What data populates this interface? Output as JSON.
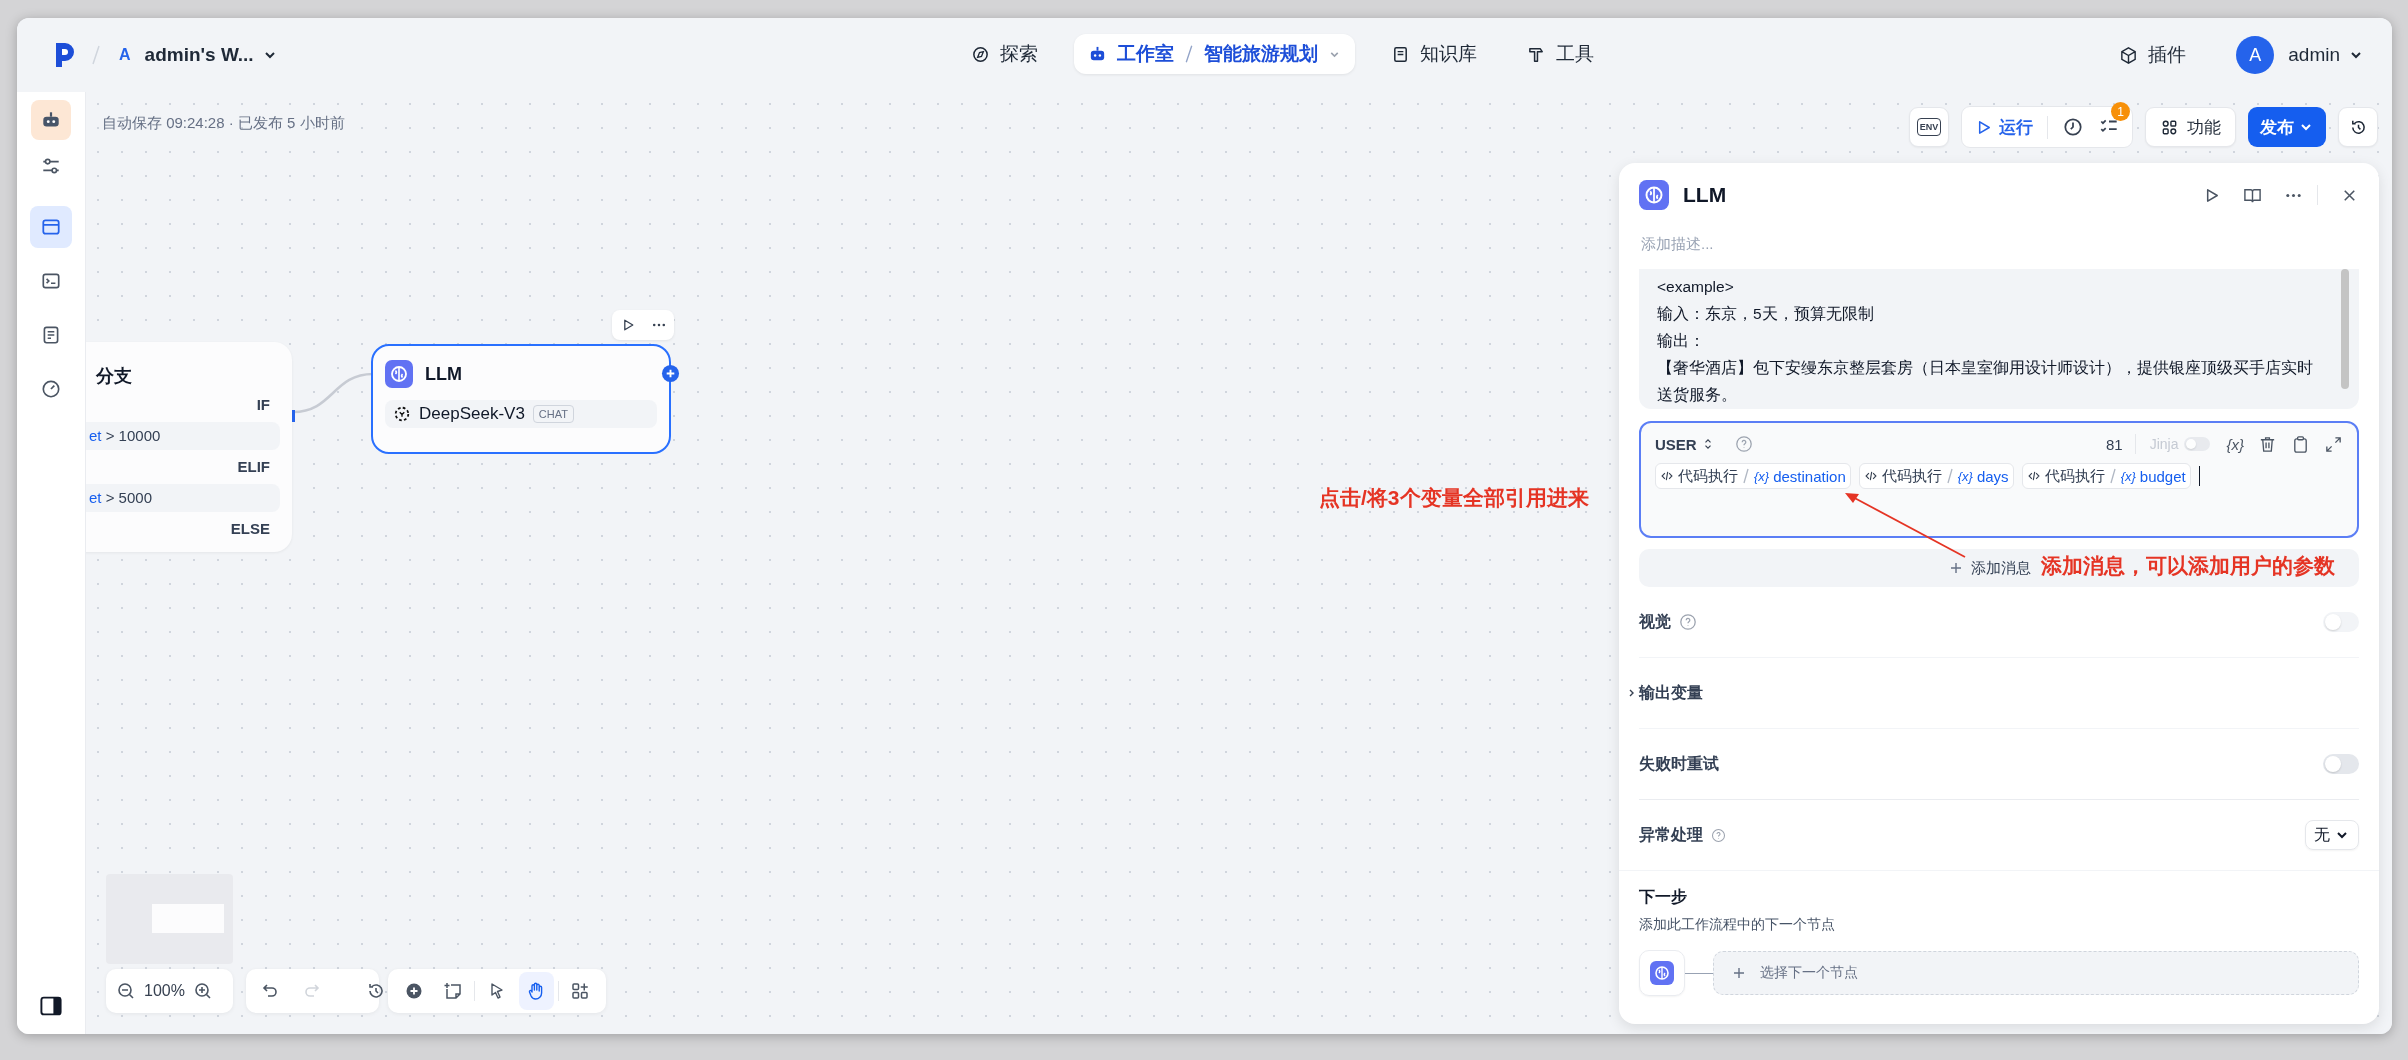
{
  "header": {
    "workspace": {
      "initial": "A",
      "name": "admin's W..."
    },
    "nav": [
      {
        "kind": "explore",
        "label": "探索",
        "selected": false
      },
      {
        "kind": "studio",
        "label": "工作室",
        "app": "智能旅游规划",
        "selected": true
      },
      {
        "kind": "knowledge",
        "label": "知识库",
        "selected": false
      },
      {
        "kind": "tools",
        "label": "工具",
        "selected": false
      }
    ],
    "plugins": "插件",
    "user": {
      "initial": "A",
      "name": "admin"
    }
  },
  "sidebar": {
    "items": [
      {
        "kind": "sliders",
        "selected": false
      },
      {
        "kind": "workflow",
        "selected": true
      },
      {
        "kind": "terminal",
        "selected": false
      },
      {
        "kind": "logs",
        "selected": false
      },
      {
        "kind": "monitor",
        "selected": false
      }
    ]
  },
  "toolbar": {
    "autosave": "自动保存 09:24:28 · 已发布 5 小时前",
    "env": "ENV",
    "run": "运行",
    "checklist_badge": "1",
    "features": "功能",
    "publish": "发布"
  },
  "canvas": {
    "if_node": {
      "title": "分支",
      "branches": [
        {
          "label": "IF",
          "variable": "et",
          "condition": "> 10000"
        },
        {
          "label": "ELIF",
          "variable": "et",
          "condition": "> 5000"
        },
        {
          "label": "ELSE"
        }
      ]
    },
    "llm_node": {
      "title": "LLM",
      "model": "DeepSeek-V3",
      "mode": "CHAT",
      "selected": true
    },
    "zoom": "100%",
    "tools": [
      {
        "kind": "add",
        "selected": false
      },
      {
        "kind": "note",
        "selected": false
      },
      {
        "kind": "pointer",
        "selected": false
      },
      {
        "kind": "hand",
        "selected": true
      },
      {
        "kind": "organize",
        "selected": false
      }
    ]
  },
  "annotations": [
    {
      "text": "点击/将3个变量全部引用进来"
    },
    {
      "text": "添加消息，可以添加用户的参数"
    }
  ],
  "panel": {
    "title": "LLM",
    "description_placeholder": "添加描述...",
    "prompt_lines": [
      "<example>",
      "输入：东京，5天，预算无限制",
      "输出：",
      "【奢华酒店】包下安缦东京整层套房（日本皇室御用设计师设计），提供银座顶级买手店实时送货服务。"
    ],
    "user_message": {
      "role": "USER",
      "count": "81",
      "jinja": {
        "label": "Jinja",
        "on": false
      },
      "variable_button": "{x}",
      "chips": [
        {
          "node": "代码执行",
          "icon": "{x}",
          "variable": "destination"
        },
        {
          "node": "代码执行",
          "icon": "{x}",
          "variable": "days"
        },
        {
          "node": "代码执行",
          "icon": "{x}",
          "variable": "budget"
        }
      ]
    },
    "add_message": "添加消息",
    "vision": {
      "label": "视觉",
      "on": false
    },
    "output_vars": {
      "label": "输出变量",
      "expanded": false
    },
    "retry": {
      "label": "失败时重试",
      "on": false
    },
    "error_handling": {
      "label": "异常处理",
      "value": "无"
    },
    "next_step": {
      "title": "下一步",
      "subtitle": "添加此工作流程中的下一个节点",
      "placeholder": "选择下一个节点"
    }
  }
}
